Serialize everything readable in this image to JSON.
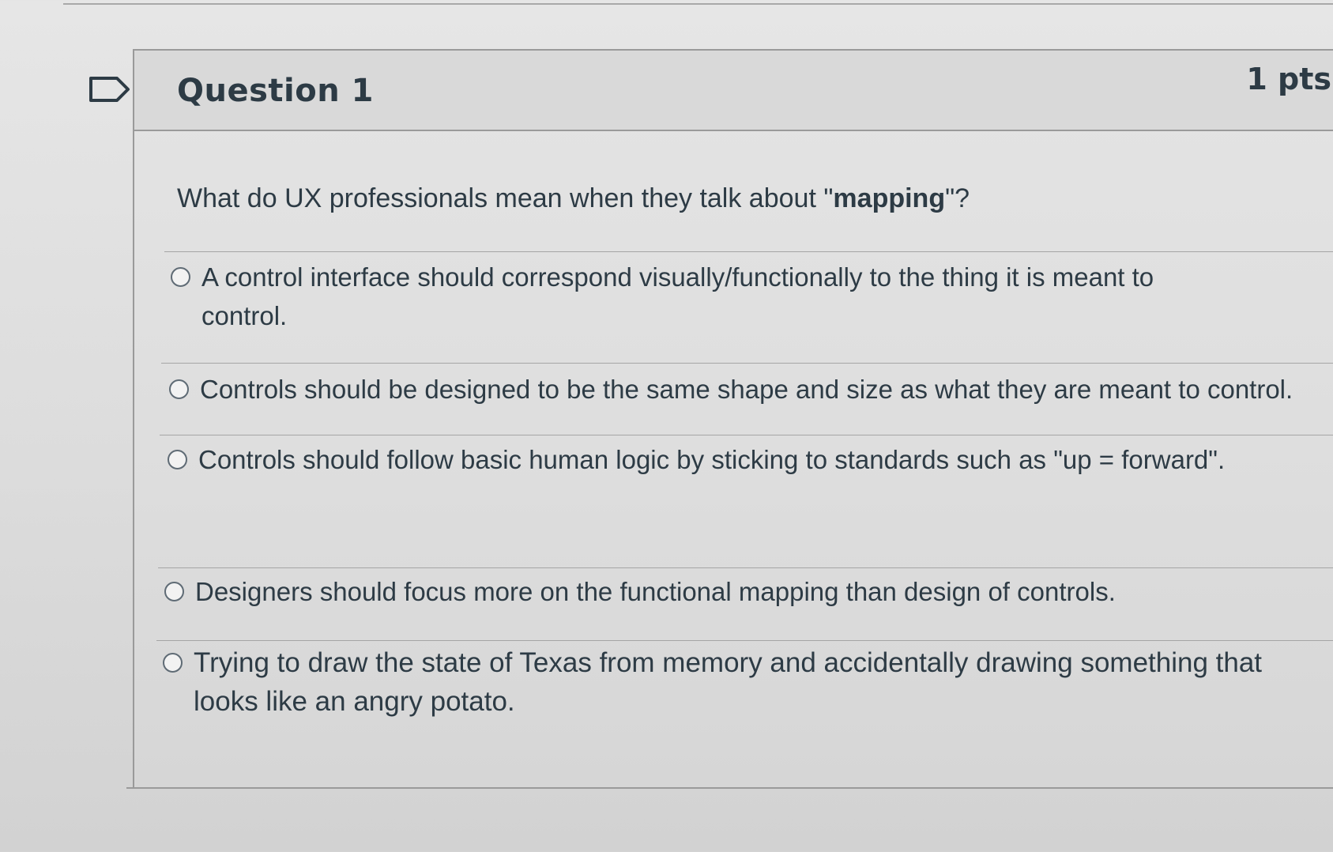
{
  "question": {
    "title": "Question 1",
    "points": "1 pts",
    "text_before": "What do UX professionals mean when they talk about \"",
    "text_emphasis": "mapping",
    "text_after": "\"?",
    "flag_icon": "flag-icon"
  },
  "answers": [
    {
      "label": "A control interface should correspond visually/functionally to the thing it is meant to control.",
      "selected": false
    },
    {
      "label": "Controls should be designed to be the same shape and size as what they are meant to control.",
      "selected": false
    },
    {
      "label": "Controls should follow basic human logic by sticking to standards such as \"up = forward\".",
      "selected": false
    },
    {
      "label": "Designers should focus more on the functional mapping than design of controls.",
      "selected": false
    },
    {
      "label": "Trying to draw the state of Texas from memory and accidentally drawing something that looks like an angry potato.",
      "selected": false
    }
  ],
  "colors": {
    "text": "#2d3b45",
    "border": "#9a9a9a",
    "radio_border": "#5f6b75"
  }
}
